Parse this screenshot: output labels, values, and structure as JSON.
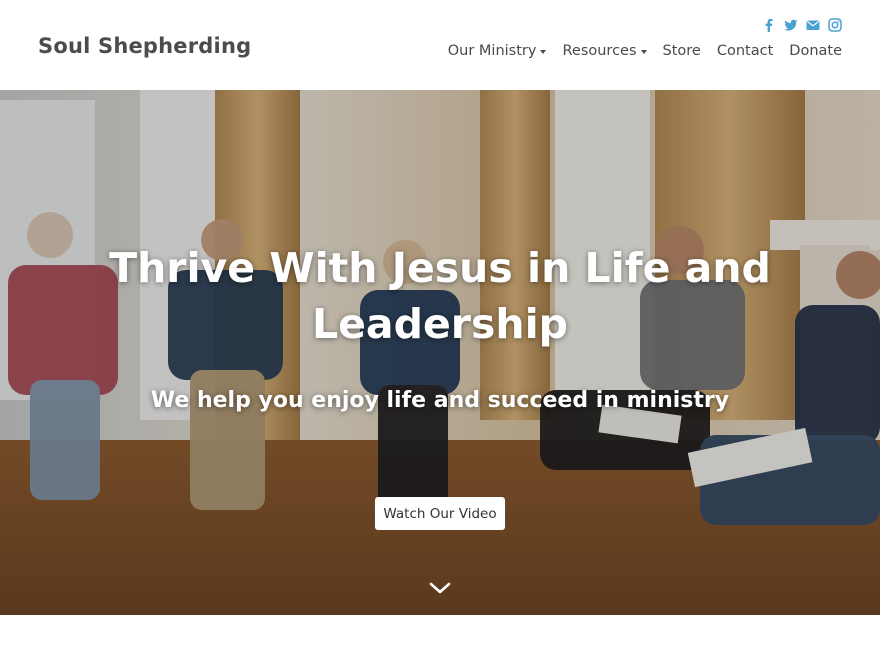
{
  "header": {
    "logo": "Soul Shepherding",
    "social": [
      {
        "icon": "facebook-icon"
      },
      {
        "icon": "twitter-icon"
      },
      {
        "icon": "email-icon"
      },
      {
        "icon": "instagram-icon"
      }
    ],
    "social_color": "#4aa3d3",
    "nav": [
      {
        "label": "Our Ministry",
        "dropdown": true
      },
      {
        "label": "Resources",
        "dropdown": true
      },
      {
        "label": "Store",
        "dropdown": false
      },
      {
        "label": "Contact",
        "dropdown": false
      },
      {
        "label": "Donate",
        "dropdown": false
      }
    ]
  },
  "hero": {
    "headline_line1": "Thrive With Jesus in Life and",
    "headline_line2": "Leadership",
    "subheadline": "We help you enjoy life and succeed in ministry",
    "cta_label": "Watch Our Video",
    "scroll_icon": "chevron-down-icon"
  }
}
